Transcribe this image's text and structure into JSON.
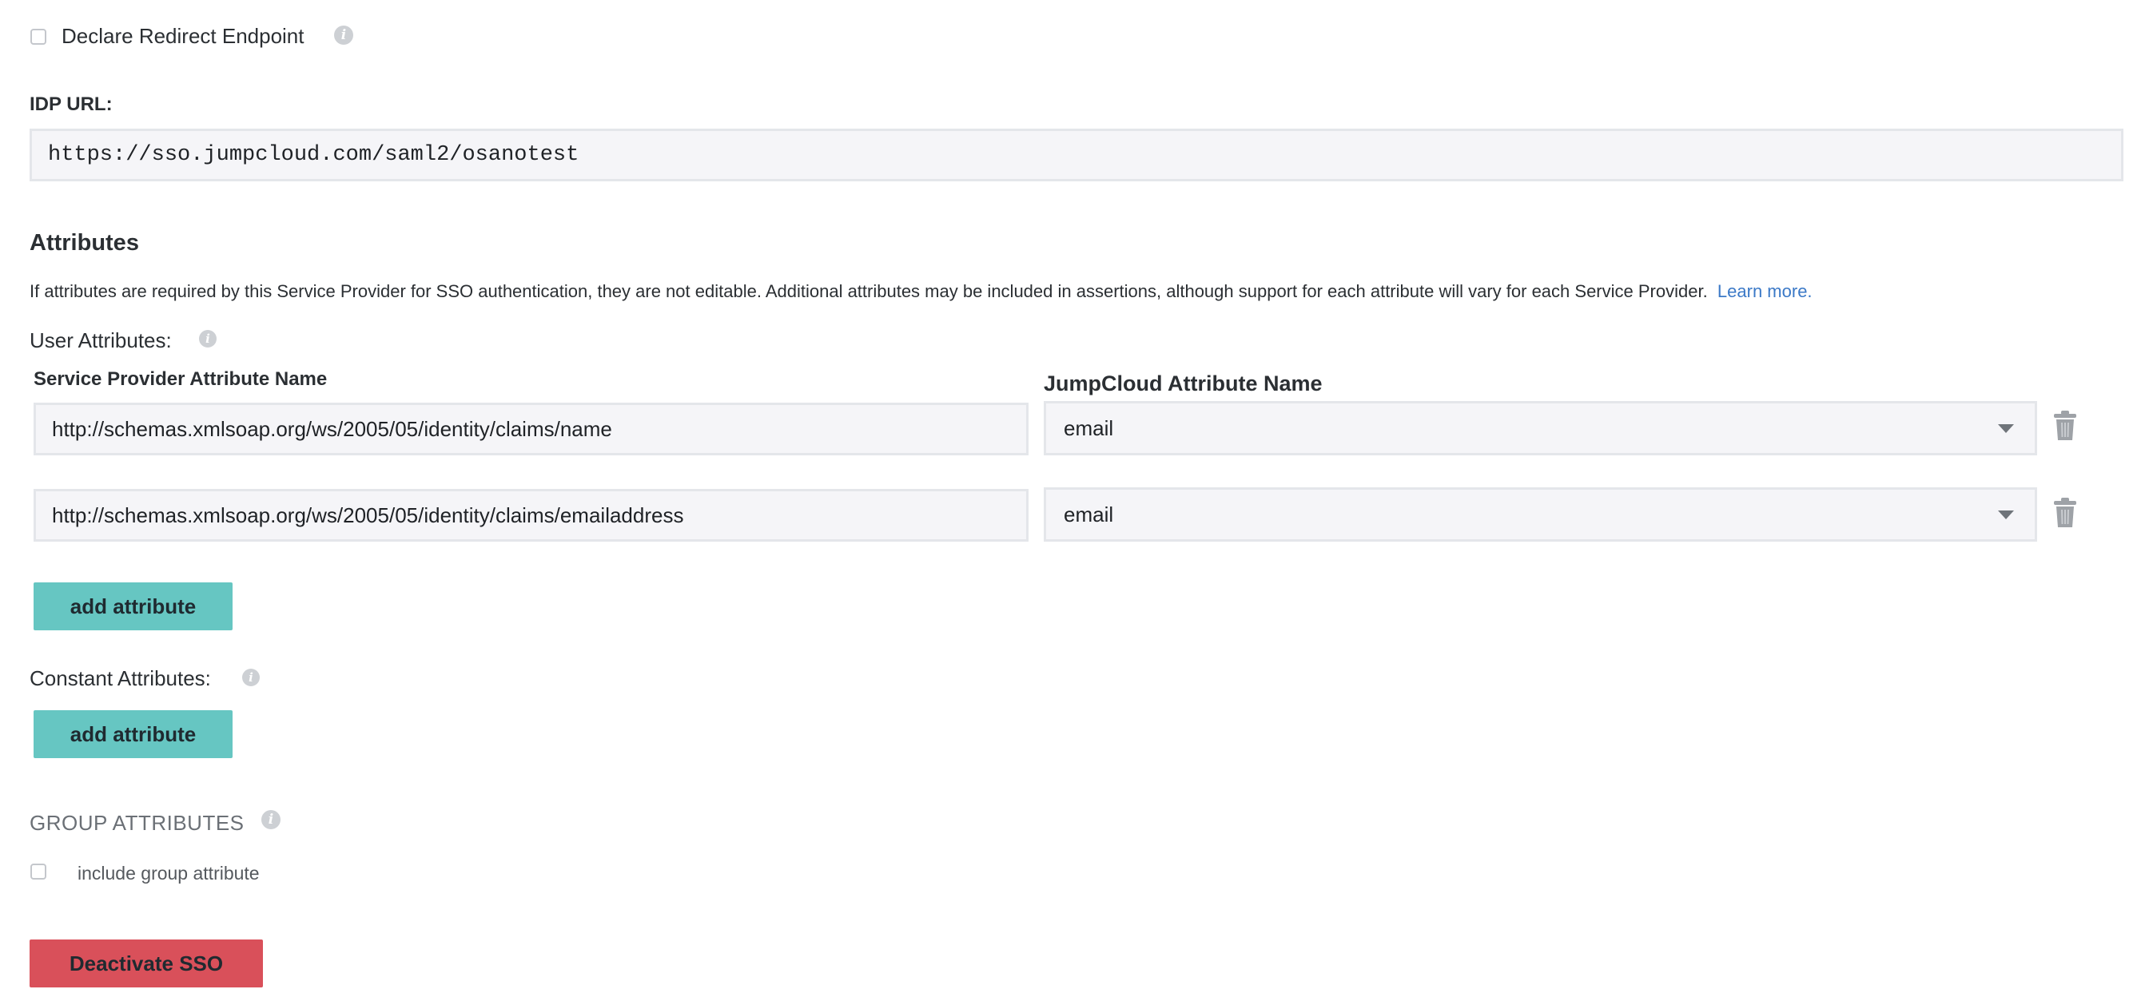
{
  "redirect_endpoint": {
    "label": "Declare Redirect Endpoint"
  },
  "idp_url": {
    "label": "IDP URL:",
    "value": "https://sso.jumpcloud.com/saml2/osanotest"
  },
  "attributes": {
    "heading": "Attributes",
    "description": "If attributes are required by this Service Provider for SSO authentication, they are not editable. Additional attributes may be included in assertions, although support for each attribute will vary for each Service Provider.",
    "learn_more": "Learn more.",
    "user_attributes_label": "User Attributes:",
    "col_sp_name": "Service Provider Attribute Name",
    "col_jc_name": "JumpCloud Attribute Name",
    "rows": [
      {
        "sp_name": "http://schemas.xmlsoap.org/ws/2005/05/identity/claims/name",
        "jc_name": "email"
      },
      {
        "sp_name": "http://schemas.xmlsoap.org/ws/2005/05/identity/claims/emailaddress",
        "jc_name": "email"
      }
    ],
    "add_attribute_label": "add attribute",
    "constant_attributes_label": "Constant Attributes:",
    "constant_add_attribute_label": "add attribute"
  },
  "group_attributes": {
    "heading": "GROUP ATTRIBUTES",
    "include_label": "include group attribute"
  },
  "deactivate_label": "Deactivate SSO",
  "colors": {
    "teal_button": "#66c6c2",
    "red_button": "#d9505a",
    "link": "#3b79c7"
  },
  "icons": [
    "info-icon",
    "trash-icon",
    "chevron-down-icon"
  ]
}
